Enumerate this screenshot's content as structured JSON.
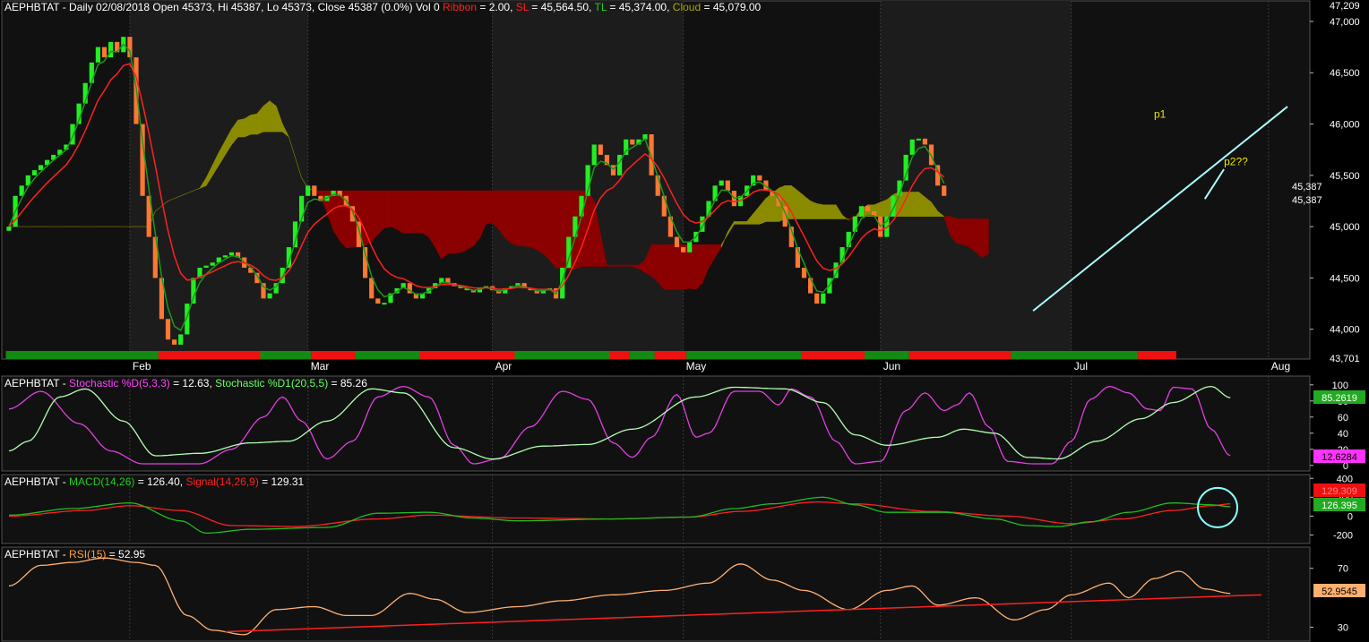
{
  "header": {
    "symbol": "AEPHBTAT",
    "price_text": " - Daily 02/08/2018 Open 45373, Hi 45387, Lo 45373, Close 45387 (0.0%) Vol 0 ",
    "ribbon_label": "Ribbon",
    "ribbon_value": " = 2.00, ",
    "sl_label": "SL",
    "sl_value": " = 45,564.50, ",
    "tl_label": "TL",
    "tl_value": " = 45,374.00, ",
    "cloud_label": "Cloud",
    "cloud_value": " = 45,079.00"
  },
  "stoch_header": {
    "prefix": " - ",
    "k_label": "Stochastic %D(5,3,3)",
    "k_value": " = 12.63, ",
    "d_label": "Stochastic %D1(20,5,5)",
    "d_value": " = 85.26"
  },
  "macd_header": {
    "prefix": " - ",
    "macd_label": "MACD(14,26)",
    "macd_value": " = 126.40, ",
    "signal_label": "Signal(14,26,9)",
    "signal_value": " = 129.31"
  },
  "rsi_header": {
    "prefix": " - ",
    "rsi_label": "RSI(15)",
    "rsi_value": " = 52.95"
  },
  "annotations": {
    "p1": "p1",
    "p2": "p2??"
  },
  "chart_data": [
    {
      "type": "candlestick",
      "panel": "price",
      "x_labels": [
        {
          "label": "Feb",
          "day": 19
        },
        {
          "label": "Mar",
          "day": 47
        },
        {
          "label": "Apr",
          "day": 76
        },
        {
          "label": "May",
          "day": 106
        },
        {
          "label": "Jun",
          "day": 137
        },
        {
          "label": "Jul",
          "day": 167
        },
        {
          "label": "Aug",
          "day": 198
        }
      ],
      "y_ticks": [
        "47,000",
        "46,500",
        "46,000",
        "45,500",
        "45,000",
        "44,500",
        "44,000"
      ],
      "y_tick_values": [
        47000,
        46500,
        46000,
        45500,
        45000,
        44500,
        44000
      ],
      "ylim": [
        43701,
        47209
      ],
      "ylim_labels": {
        "top": "47,209",
        "bottom": "43,701"
      },
      "last_value_labels": [
        "45,387",
        "45,387"
      ],
      "closes": [
        45000,
        45300,
        45400,
        45500,
        45550,
        45600,
        45650,
        45700,
        45750,
        45800,
        46000,
        46200,
        46400,
        46600,
        46750,
        46650,
        46800,
        46700,
        46850,
        46650,
        46000,
        45300,
        44900,
        44500,
        44100,
        43900,
        43850,
        43950,
        44250,
        44500,
        44600,
        44620,
        44650,
        44700,
        44720,
        44750,
        44700,
        44600,
        44550,
        44450,
        44300,
        44350,
        44450,
        44600,
        44800,
        45050,
        45300,
        45400,
        45300,
        45250,
        45300,
        45350,
        45300,
        45200,
        45050,
        44800,
        44500,
        44300,
        44250,
        44250,
        44350,
        44400,
        44450,
        44350,
        44300,
        44350,
        44400,
        44450,
        44500,
        44450,
        44420,
        44400,
        44380,
        44360,
        44400,
        44420,
        44380,
        44350,
        44400,
        44420,
        44450,
        44400,
        44380,
        44350,
        44380,
        44400,
        44300,
        44600,
        44900,
        45100,
        45300,
        45600,
        45800,
        45700,
        45600,
        45500,
        45700,
        45850,
        45800,
        45850,
        45900,
        45500,
        45300,
        45100,
        44900,
        44800,
        44750,
        44850,
        44950,
        45100,
        45250,
        45400,
        45450,
        45350,
        45200,
        45300,
        45400,
        45500,
        45450,
        45350,
        45300,
        45200,
        45000,
        44800,
        44600,
        44500,
        44350,
        44250,
        44350,
        44500,
        44650,
        44800,
        44950,
        45100,
        45200,
        45150,
        45100,
        44900,
        45100,
        45300,
        45450,
        45700,
        45850,
        45850,
        45800,
        45600,
        45400,
        45300
      ],
      "bullish_color": "#22ee22",
      "bearish_color": "#ff7733",
      "cloud_bull_color": "#8b8b00",
      "cloud_bear_color": "#8b0000",
      "tl_color": "#1a9a1a",
      "sl_color": "#ff2020",
      "trendline_color": "#aaffff",
      "ribbon": [
        {
          "color": "green",
          "from": 0,
          "to": 24
        },
        {
          "color": "red",
          "from": 24,
          "to": 40
        },
        {
          "color": "green",
          "from": 40,
          "to": 48
        },
        {
          "color": "red",
          "from": 48,
          "to": 55
        },
        {
          "color": "green",
          "from": 55,
          "to": 65
        },
        {
          "color": "red",
          "from": 65,
          "to": 80
        },
        {
          "color": "green",
          "from": 80,
          "to": 95
        },
        {
          "color": "red",
          "from": 95,
          "to": 98
        },
        {
          "color": "green",
          "from": 98,
          "to": 102
        },
        {
          "color": "red",
          "from": 102,
          "to": 107
        },
        {
          "color": "green",
          "from": 107,
          "to": 125
        },
        {
          "color": "red",
          "from": 125,
          "to": 135
        },
        {
          "color": "green",
          "from": 135,
          "to": 142
        },
        {
          "color": "red",
          "from": 142,
          "to": 158
        },
        {
          "color": "green",
          "from": 158,
          "to": 178
        },
        {
          "color": "red",
          "from": 178,
          "to": 184
        }
      ]
    },
    {
      "type": "line",
      "panel": "stochastic",
      "y_ticks": [
        "100",
        "80",
        "60",
        "40",
        "20",
        "0"
      ],
      "y_tick_values": [
        100,
        80,
        60,
        40,
        20,
        0
      ],
      "ylim": [
        0,
        100
      ],
      "last_values": {
        "k": "12.6284",
        "d": "85.2619"
      },
      "k_color": "#e040e0",
      "d_color": "#b0ffb0"
    },
    {
      "type": "line",
      "panel": "macd",
      "y_ticks": [
        "400",
        "200",
        "0",
        "-200"
      ],
      "y_tick_values": [
        400,
        200,
        0,
        -200
      ],
      "ylim": [
        -300,
        450
      ],
      "last_values": {
        "signal": "129.309",
        "macd": "126.395"
      },
      "macd_color": "#22bb22",
      "signal_color": "#ff2020"
    },
    {
      "type": "line",
      "panel": "rsi",
      "y_ticks": [
        "70",
        "30"
      ],
      "y_tick_values": [
        70,
        30
      ],
      "ylim": [
        20,
        85
      ],
      "last_value": "52.9545",
      "rsi_color": "#ffb070"
    }
  ]
}
